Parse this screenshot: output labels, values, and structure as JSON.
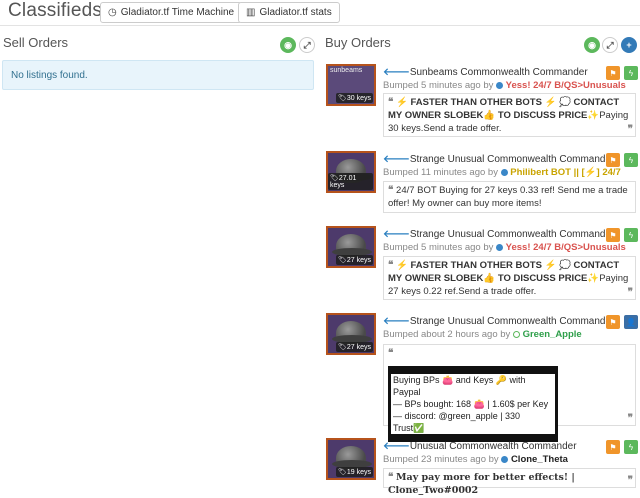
{
  "header": {
    "title": "Classifieds",
    "buttons": [
      {
        "icon": "clock-icon",
        "label": "Gladiator.tf Time Machine"
      },
      {
        "icon": "bar-chart-icon",
        "label": "Gladiator.tf stats"
      }
    ]
  },
  "sell": {
    "heading": "Sell Orders",
    "empty_text": "No listings found."
  },
  "buy": {
    "heading": "Buy Orders",
    "listings": [
      {
        "name": "Sunbeams Commonwealth Commander",
        "image_label": "sunbeams",
        "keys": "30 keys",
        "bumped_prefix": "Bumped 5 minutes ago by",
        "user": "Yess! 24/7 B/QS>Unusuals",
        "message_bold": "⚡ FASTER THAN OTHER BOTS ⚡ 💭 CONTACT MY OWNER SLOBEK👍 TO DISCUSS PRICE",
        "message": "✨Paying 30 keys.Send a trade offer."
      },
      {
        "name": "Strange Unusual Commonwealth Commander",
        "keys": "27.01 keys",
        "bumped_prefix": "Bumped 11 minutes ago by",
        "user": "Philibert BOT || [⚡] 24/7",
        "message": "24/7 BOT Buying for 27 keys 0.33 ref! Send me a trade offer! My owner can buy more items!"
      },
      {
        "name": "Strange Unusual Commonwealth Commander",
        "keys": "27 keys",
        "bumped_prefix": "Bumped 5 minutes ago by",
        "user": "Yess! 24/7 B/QS>Unusuals",
        "message_bold": "⚡ FASTER THAN OTHER BOTS ⚡ 💭 CONTACT MY OWNER SLOBEK👍 TO DISCUSS PRICE",
        "message": "✨Paying 27 keys 0.22 ref.Send a trade offer."
      },
      {
        "name": "Strange Unusual Commonwealth Commander",
        "keys": "27 keys",
        "bumped_prefix": "Bumped about 2 hours ago by",
        "user": "Green_Apple",
        "lines": [
          "Buying BPs 👛 and Keys 🔑 with Paypal",
          "— BPs bought: 168 👛 | 1.60$ per Key",
          "— discord: @green_apple | 330 Trust✅"
        ]
      },
      {
        "name": "Unusual Commonwealth Commander",
        "keys": "19 keys",
        "bumped_prefix": "Bumped 23 minutes ago by",
        "user": "Clone_Theta",
        "message": "May pay more for better effects! | Clone_Two#0002"
      }
    ]
  }
}
